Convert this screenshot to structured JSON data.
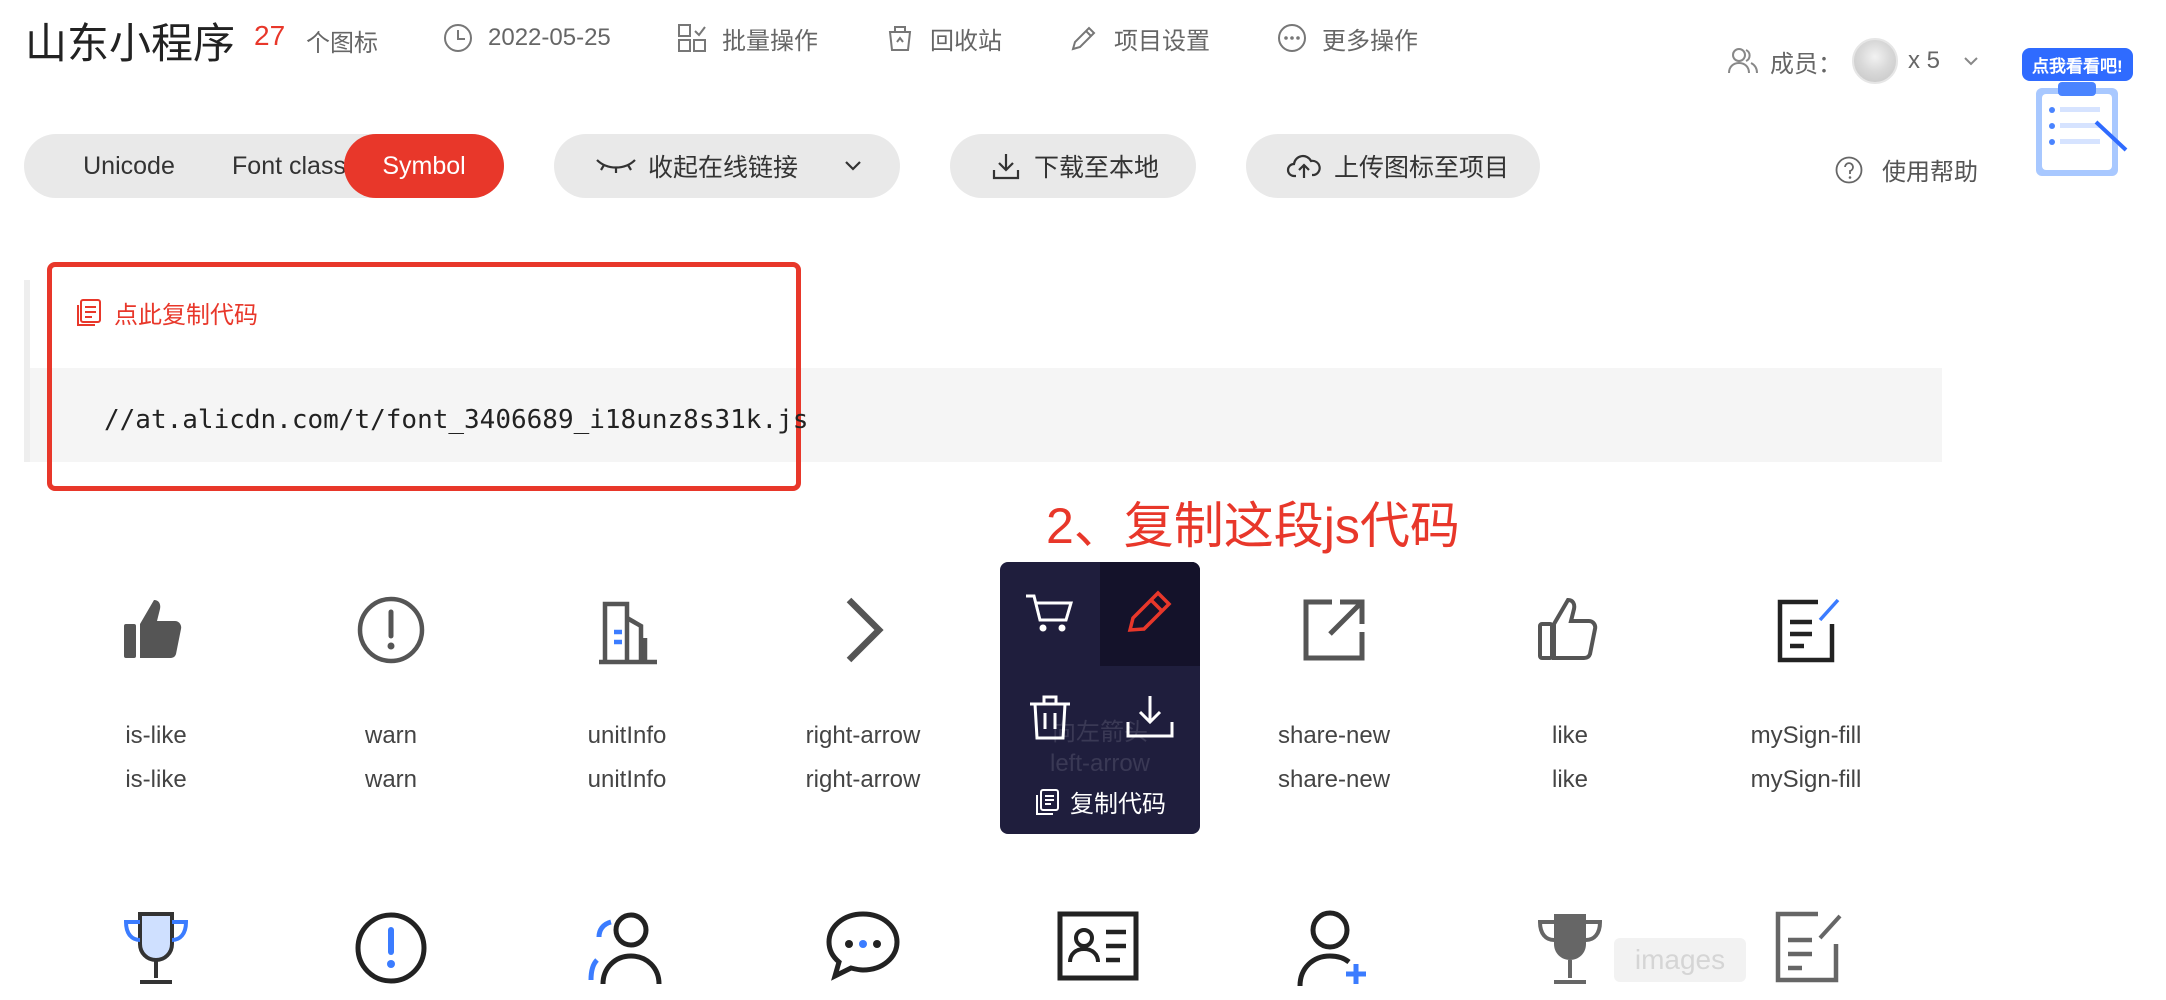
{
  "header": {
    "project_title": "山东小程序",
    "icon_count": "27",
    "icon_count_label": "个图标",
    "date": "2022-05-25",
    "batch_ops": "批量操作",
    "recycle_bin": "回收站",
    "project_settings": "项目设置",
    "more_ops": "更多操作",
    "members_label": "成员：",
    "members_count": "x 5",
    "promo_badge": "点我看看吧!"
  },
  "toolbar": {
    "tabs": [
      "Unicode",
      "Font class",
      "Symbol"
    ],
    "active_tab": "Symbol",
    "collapse_link": "收起在线链接",
    "download_local": "下载至本地",
    "upload_icons": "上传图标至项目",
    "help": "使用帮助"
  },
  "code": {
    "copy_label": "点此复制代码",
    "url": "//at.alicdn.com/t/font_3406689_i18unz8s31k.js"
  },
  "annotation": "2、复制这段js代码",
  "icons": [
    {
      "icon": "thumb-up-filled-icon",
      "name": "is-like",
      "code": "is-like"
    },
    {
      "icon": "warn-icon",
      "name": "warn",
      "code": "warn"
    },
    {
      "icon": "building-icon",
      "name": "unitInfo",
      "code": "unitInfo"
    },
    {
      "icon": "right-arrow-icon",
      "name": "right-arrow",
      "code": "right-arrow"
    },
    {
      "icon": "left-arrow-icon",
      "name": "",
      "code": ""
    },
    {
      "icon": "share-new-icon",
      "name": "share-new",
      "code": "share-new"
    },
    {
      "icon": "thumb-up-outline-icon",
      "name": "like",
      "code": "like"
    },
    {
      "icon": "sign-edit-icon",
      "name": "mySign-fill",
      "code": "mySign-fill"
    }
  ],
  "icons_row2": [
    "trophy-icon",
    "alert-circle-icon",
    "users-icon",
    "chat-icon",
    "id-card-icon",
    "add-user-icon",
    "cup-icon",
    "edit-note-icon"
  ],
  "hover": {
    "copy_code": "复制代码",
    "behind_text_1": "向左箭头",
    "behind_text_2": "left-arrow"
  },
  "watermark": "images",
  "colors": {
    "accent": "#e8372a",
    "overlay": "#1f1e3d",
    "pill": "#e9e9e9",
    "blue": "#2f6bff"
  }
}
